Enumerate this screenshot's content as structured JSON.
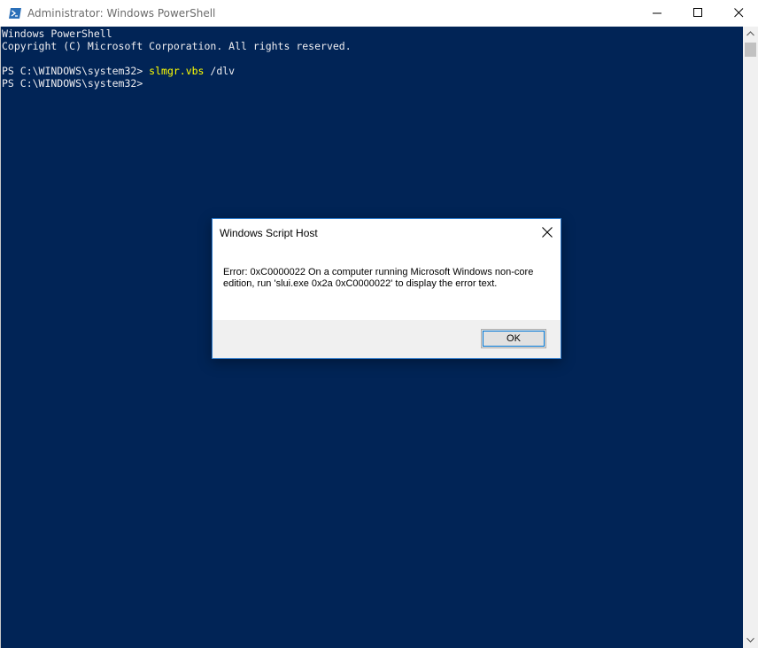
{
  "window": {
    "title": "Administrator: Windows PowerShell",
    "icon": "powershell-icon"
  },
  "console": {
    "lines": [
      "Windows PowerShell",
      "Copyright (C) Microsoft Corporation. All rights reserved.",
      "",
      "PS C:\\WINDOWS\\system32> ",
      "PS C:\\WINDOWS\\system32>"
    ],
    "command": "slmgr.vbs",
    "command_args": " /dlv",
    "colors": {
      "background": "#012456",
      "text": "#eeedf0",
      "command": "#ffff00"
    }
  },
  "dialog": {
    "title": "Windows Script Host",
    "message": "Error: 0xC0000022 On a computer running Microsoft Windows non-core edition, run 'slui.exe 0x2a 0xC0000022' to display the error text.",
    "ok_label": "OK"
  }
}
